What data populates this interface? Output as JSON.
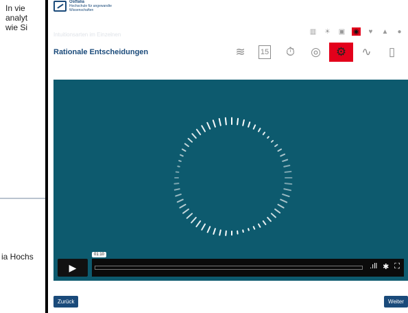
{
  "background_page": {
    "lines": [
      "In vie",
      "analyt",
      "wie Si"
    ],
    "footer_text": "ia Hochs"
  },
  "header": {
    "logo": {
      "brand": "Ostfalia",
      "line1": "Hochschule für angewandte",
      "line2": "Wissenschaften"
    },
    "breadcrumb": "Intuitionsarten im Einzelnen",
    "title": "Rationale Entscheidungen"
  },
  "nav_small_icons": [
    {
      "name": "chart-icon",
      "glyph": "▥",
      "active": false
    },
    {
      "name": "sun-icon",
      "glyph": "☀",
      "active": false
    },
    {
      "name": "briefcase-icon",
      "glyph": "▣",
      "active": false
    },
    {
      "name": "brain-icon",
      "glyph": "◉",
      "active": true
    },
    {
      "name": "hands-heart-icon",
      "glyph": "♥",
      "active": false
    },
    {
      "name": "graduation-cap-icon",
      "glyph": "▲",
      "active": false
    },
    {
      "name": "person-icon",
      "glyph": "●",
      "active": false
    }
  ],
  "nav_big_icons": [
    {
      "name": "wave-book-icon",
      "glyph": "≋",
      "active": false
    },
    {
      "name": "calendar-icon",
      "glyph": "15",
      "active": false
    },
    {
      "name": "stopwatch-icon",
      "glyph": "⏱",
      "active": false
    },
    {
      "name": "crystal-ball-icon",
      "glyph": "◎",
      "active": false
    },
    {
      "name": "gears-icon",
      "glyph": "⚙",
      "active": true
    },
    {
      "name": "hand-wave-icon",
      "glyph": "∿",
      "active": false
    },
    {
      "name": "phone-hand-icon",
      "glyph": "▯",
      "active": false
    }
  ],
  "video": {
    "time_tooltip": "01:10",
    "progress": 0.0
  },
  "buttons": {
    "back": "Zurück",
    "next": "Weiter"
  },
  "colors": {
    "brand_blue": "#1a4a7a",
    "active_red": "#e3001b",
    "video_bg": "#0d5a6e"
  }
}
